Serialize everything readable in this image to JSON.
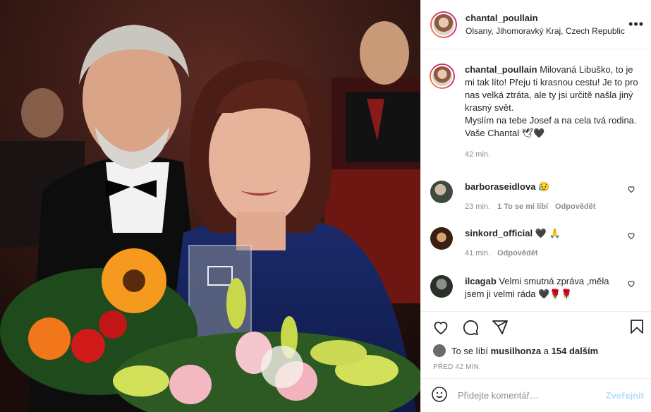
{
  "post": {
    "username": "chantal_poullain",
    "location": "Olsany, Jihomoravký Kraj, Czech Republic",
    "caption_text": "Milovaná Libuško, to je mi tak líto! Přeju ti krasnou cestu! Je to pro nas velká ztráta, ale ty jsi určitě našla jiný krasný svět.",
    "caption_text2": "Myslím na tebe Josef a na cela tvá rodina. Vaše Chantal 🕊🖤",
    "caption_time": "42 min."
  },
  "comments": [
    {
      "user": "barboraseidlova",
      "text": "😥",
      "time": "23 min.",
      "likes": "1 To se mi líbí",
      "reply": "Odpovědět"
    },
    {
      "user": "sinkord_official",
      "text": "🖤 🙏",
      "time": "41 min.",
      "reply": "Odpovědět"
    },
    {
      "user": "ilcagab",
      "text": "Velmi smutná zpráva ,měla jsem ji velmi ráda 🖤🌹🌹"
    }
  ],
  "likes": {
    "prefix": "To se líbí",
    "user": "musilhonza",
    "joiner": "a",
    "others": "154 dalším"
  },
  "posted_ago": "PŘED 42 MIN.",
  "add_comment": {
    "placeholder": "Přidejte komentář…",
    "post_label": "Zveřejnit"
  },
  "icons": [
    "more-icon",
    "heart-icon",
    "comment-icon",
    "share-icon",
    "save-icon",
    "emoji-icon"
  ],
  "colors": {
    "accent_disabled": "#b2dffc",
    "muted": "#8e8e8e",
    "text": "#262626"
  }
}
